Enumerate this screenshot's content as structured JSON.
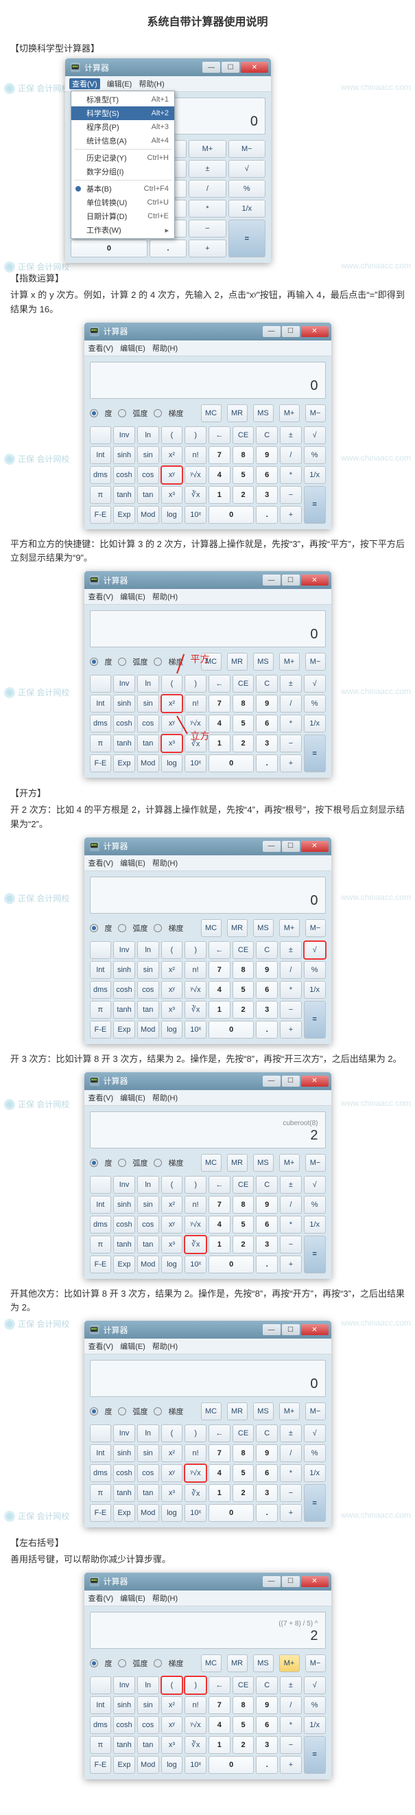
{
  "doc": {
    "title": "系统自带计算器使用说明"
  },
  "sections": {
    "switch": "【切换科学型计算器】",
    "exponent": "【指数运算】",
    "root": "【开方】",
    "paren": "【左右括号】"
  },
  "paras": {
    "exp_intro": "计算 x 的 y 次方。例如，计算 2 的 4 次方，先输入 2，点击“xʸ”按钮，再输入 4，最后点击“=”即得到结果为 16。",
    "sq_cube": "平方和立方的快捷键：比如计算 3 的 2 次方，计算器上操作就是，先按“3”，再按“平方”，按下平方后立刻显示结果为“9”。",
    "root2": "开 2 次方：比如 4 的平方根是 2，计算器上操作就是，先按“4”，再按“根号”，按下根号后立刻显示结果为“2”。",
    "root3": "开 3 次方：比如计算 8 开 3 次方，结果为 2。操作是，先按“8”，再按“开三次方”，之后出结果为 2。",
    "rootn": "开其他次方：比如计算 8 开 3 次方，结果为 2。操作是，先按“8”，再按“开方”，再按“3”，之后出结果为 2。",
    "paren": "善用括号键，可以帮助你减少计算步骤。"
  },
  "anno": {
    "square_label": "平方",
    "cube_label": "立方"
  },
  "calc": {
    "win_title": "计算器",
    "menu": {
      "view": "查看(V)",
      "edit": "编辑(E)",
      "help": "帮助(H)"
    },
    "display_zero": "0",
    "display_cuberoot_hint": "cuberoot(8)",
    "display_cuberoot_val": "2",
    "display_paren": "((7 + 8) / 5) ^",
    "display_paren_val": "2",
    "mode": {
      "deg": "度",
      "rad": "弧度",
      "grad": "梯度"
    },
    "mem": [
      "MC",
      "MR",
      "MS",
      "M+",
      "M−"
    ],
    "row1_left": [
      "",
      "Inv",
      "ln",
      "("
    ],
    "row1_right": [
      ")",
      "←",
      "CE",
      "C",
      "±",
      "√"
    ],
    "row2_left": [
      "Int",
      "sinh",
      "sin",
      "x²",
      "n!"
    ],
    "row2_right": [
      "7",
      "8",
      "9",
      "/",
      "%"
    ],
    "row3_left": [
      "dms",
      "cosh",
      "cos",
      "xʸ",
      "ʸ√x"
    ],
    "row3_right": [
      "4",
      "5",
      "6",
      "*",
      "1/x"
    ],
    "row4_left": [
      "π",
      "tanh",
      "tan",
      "x³",
      "∛x"
    ],
    "row4_right": [
      "1",
      "2",
      "3",
      "−",
      "="
    ],
    "row5_left": [
      "F-E",
      "Exp",
      "Mod",
      "log",
      "10ˣ"
    ],
    "row5_right": [
      "0",
      ".",
      "+"
    ]
  },
  "viewmenu": {
    "items": [
      {
        "label": "标准型(T)",
        "sc": "Alt+1",
        "dot": false
      },
      {
        "label": "科学型(S)",
        "sc": "Alt+2",
        "dot": true,
        "sel": true
      },
      {
        "label": "程序员(P)",
        "sc": "Alt+3",
        "dot": false
      },
      {
        "label": "统计信息(A)",
        "sc": "Alt+4",
        "dot": false
      }
    ],
    "hist": {
      "label": "历史记录(Y)",
      "sc": "Ctrl+H"
    },
    "digitgrp": {
      "label": "数字分组(I)"
    },
    "items2": [
      {
        "label": "基本(B)",
        "sc": "Ctrl+F4",
        "dot": true
      },
      {
        "label": "单位转换(U)",
        "sc": "Ctrl+U"
      },
      {
        "label": "日期计算(D)",
        "sc": "Ctrl+E"
      }
    ],
    "sheet": {
      "label": "工作表(W)"
    }
  },
  "watermark": {
    "brand": "正保 会计网校",
    "url": "www.chinaacc.com"
  }
}
